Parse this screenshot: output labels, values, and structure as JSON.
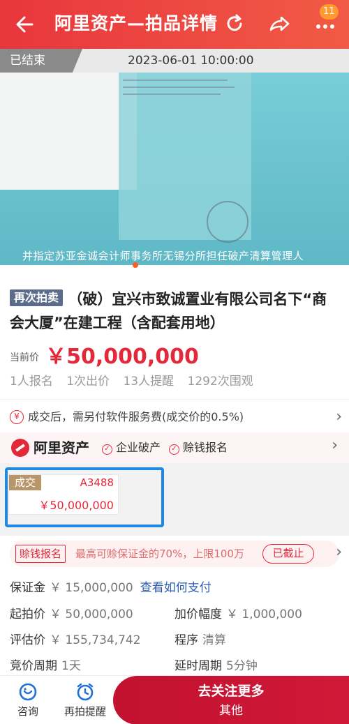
{
  "header": {
    "title": "阿里资产—拍品详情",
    "notification_count": "11",
    "background_color": "#e8363d"
  },
  "status": {
    "state_label": "已结束",
    "end_time": "2023-06-01 10:00:00"
  },
  "hero": {
    "caption": "并指定苏亚金诚会计师事务所无锡分所担任破产清算管理人"
  },
  "item": {
    "tag": "再次拍卖",
    "title": "（破）宜兴市致诚置业有限公司名下“商会大厦”在建工程（含配套用地）",
    "price_label": "当前价",
    "price": "￥50,000,000",
    "stats": [
      "1人报名",
      "1次出价",
      "13人提醒",
      "1292次围观"
    ]
  },
  "fee": {
    "icon": "yen",
    "text": "成交后，需另付软件服务费(成交价的0.5%)"
  },
  "platform": {
    "name": "阿里资产",
    "tags": [
      "企业破产",
      "赊钱报名"
    ]
  },
  "bid": {
    "status": "成交",
    "bidder_code": "A3488",
    "amount": "￥50,000,000"
  },
  "deposit_promo": {
    "tag": "赊钱报名",
    "text": "最高可赊保证金的70%，上限100万",
    "button": "已截止"
  },
  "details": {
    "deposit_label": "保证金",
    "deposit_value": "￥ 15,000,000",
    "deposit_link": "查看如何支付",
    "start_price_label": "起拍价",
    "start_price_value": "￥ 50,000,000",
    "increment_label": "加价幅度",
    "increment_value": "￥ 1,000,000",
    "appraisal_label": "评估价",
    "appraisal_value": "￥ 155,734,742",
    "procedure_label": "程序",
    "procedure_value": "清算",
    "cycle_label": "竞价周期",
    "cycle_value": "1天",
    "delay_label": "延时周期",
    "delay_value": "5分钟"
  },
  "bottom_bar": {
    "ask_label": "咨询",
    "remind_label": "再拍提醒",
    "follow_line1": "去关注更多",
    "follow_line2": "其他"
  }
}
